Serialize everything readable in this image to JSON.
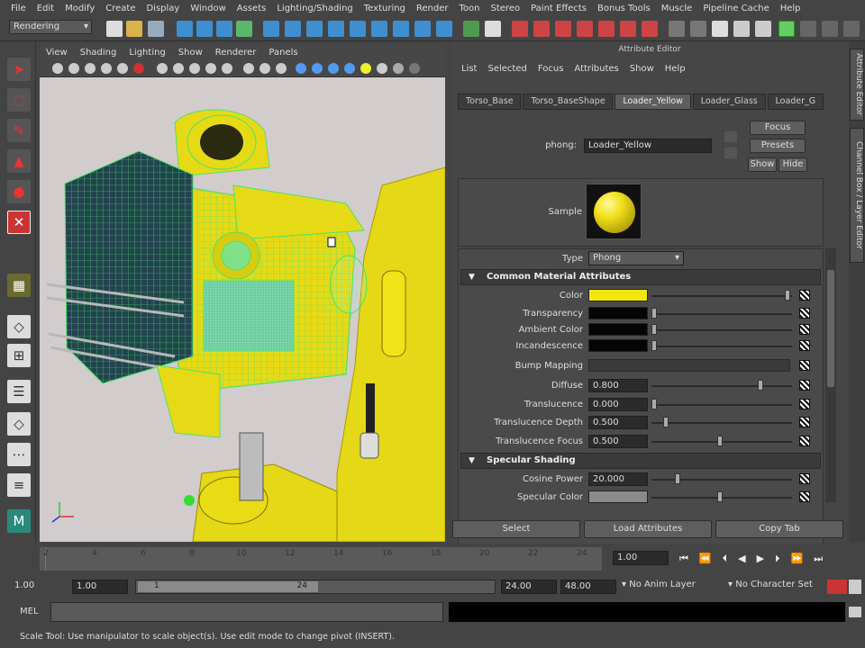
{
  "menubar": [
    "File",
    "Edit",
    "Modify",
    "Create",
    "Display",
    "Window",
    "Assets",
    "Lighting/Shading",
    "Texturing",
    "Render",
    "Toon",
    "Stereo",
    "Paint Effects",
    "Bonus Tools",
    "Muscle",
    "Pipeline Cache",
    "Help"
  ],
  "shelf": {
    "mode": "Rendering"
  },
  "viewport": {
    "menu": [
      "View",
      "Shading",
      "Lighting",
      "Show",
      "Renderer",
      "Panels"
    ]
  },
  "attribute_editor": {
    "title": "Attribute Editor",
    "menu": [
      "List",
      "Selected",
      "Focus",
      "Attributes",
      "Show",
      "Help"
    ],
    "tabs": [
      "Torso_Base",
      "Torso_BaseShape",
      "Loader_Yellow",
      "Loader_Glass",
      "Loader_G"
    ],
    "active_tab": "Loader_Yellow",
    "node_label": "phong:",
    "node_name": "Loader_Yellow",
    "buttons": {
      "focus": "Focus",
      "presets": "Presets",
      "show": "Show",
      "hide": "Hide"
    },
    "sample_label": "Sample",
    "type_label": "Type",
    "type_value": "Phong",
    "section_common": "Common Material Attributes",
    "section_specular": "Specular Shading",
    "attrs": {
      "color": "Color",
      "transparency": "Transparency",
      "ambient": "Ambient Color",
      "incandescence": "Incandescence",
      "bump": "Bump Mapping",
      "diffuse": "Diffuse",
      "translucence": "Translucence",
      "trans_depth": "Translucence Depth",
      "trans_focus": "Translucence Focus",
      "cosine": "Cosine Power",
      "spec_color": "Specular Color"
    },
    "values": {
      "diffuse": "0.800",
      "translucence": "0.000",
      "trans_depth": "0.500",
      "trans_focus": "0.500",
      "cosine": "20.000"
    },
    "bottom": {
      "select": "Select",
      "load": "Load Attributes",
      "copy": "Copy Tab"
    },
    "colors": {
      "color": "#f2e60f",
      "spec_color": "#8a8a8a"
    }
  },
  "side_tabs": [
    "Attribute Editor",
    "Channel Box / Layer Editor"
  ],
  "timeslider": {
    "ticks": [
      "2",
      "4",
      "6",
      "8",
      "10",
      "12",
      "14",
      "16",
      "18",
      "20",
      "22",
      "24"
    ],
    "current": "1.00"
  },
  "rangebar": {
    "start": "1.00",
    "playback_start": "1.00",
    "slider_start": "1",
    "slider_end": "24",
    "playback_end": "24.00",
    "end": "48.00",
    "anim_layer": "No Anim Layer",
    "char_set": "No Character Set"
  },
  "cmdline": {
    "label": "MEL"
  },
  "helpline": {
    "text": "Scale Tool: Use manipulator to scale object(s). Use edit mode to change pivot (INSERT)."
  }
}
